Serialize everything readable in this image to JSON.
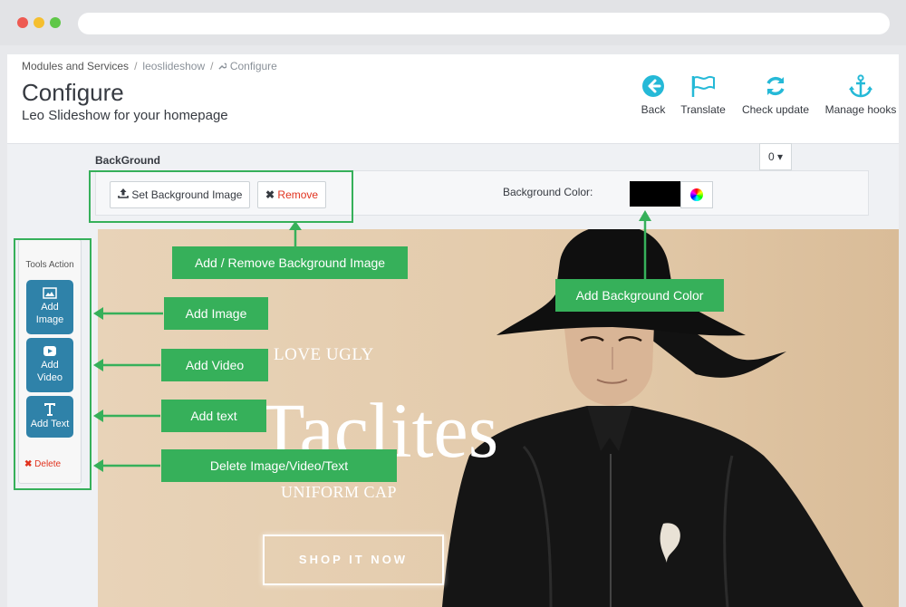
{
  "browser": {
    "dots": [
      "#ee5a52",
      "#f5bf2f",
      "#5fc748"
    ]
  },
  "breadcrumb": {
    "item1": "Modules and Services",
    "item2": "leoslideshow",
    "item3": "Configure",
    "separator": "/"
  },
  "header": {
    "title": "Configure",
    "subtitle": "Leo Slideshow for your homepage"
  },
  "toolbar": [
    {
      "label": "Back",
      "icon": "back-arrow-icon"
    },
    {
      "label": "Translate",
      "icon": "flag-icon"
    },
    {
      "label": "Check update",
      "icon": "refresh-icon"
    },
    {
      "label": "Manage hooks",
      "icon": "anchor-icon"
    }
  ],
  "background": {
    "section_label": "BackGround",
    "dropdown_value": "0",
    "set_image_label": "Set Background Image",
    "remove_label": "Remove",
    "color_label": "Background Color:",
    "color_value": "#000000"
  },
  "tools": {
    "title": "Tools Action",
    "add_image": [
      "Add",
      "Image"
    ],
    "add_video": [
      "Add",
      "Video"
    ],
    "add_text": "Add Text",
    "delete_label": "Delete"
  },
  "slide": {
    "tagline": "LOVE UGLY",
    "headline": "Taclites",
    "caption": "UNIFORM CAP",
    "cta": "SHOP IT NOW"
  },
  "callouts": {
    "bg_image": "Add / Remove Background Image",
    "bg_color": "Add Background Color",
    "add_image": "Add Image",
    "add_video": "Add Video",
    "add_text": "Add text",
    "delete": "Delete Image/Video/Text"
  },
  "colors": {
    "accent_green": "#36b05a",
    "tool_blue": "#2f82a9",
    "toolbar_icon": "#25b9d7",
    "danger": "#e1331f"
  }
}
